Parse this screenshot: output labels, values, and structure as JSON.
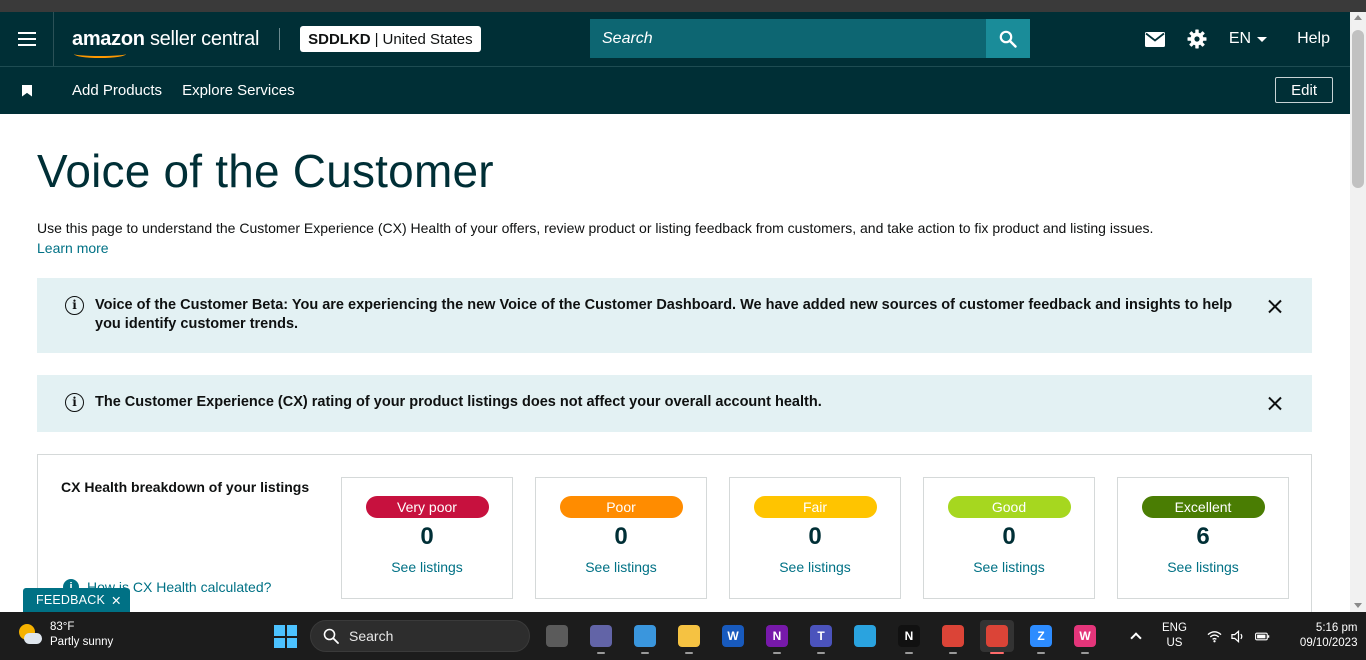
{
  "header": {
    "logo_brand": "amazon",
    "logo_product": "seller central",
    "store_code": "SDDLKD",
    "store_separator": "|",
    "store_country": "United States",
    "search_placeholder": "Search",
    "language": "EN",
    "help": "Help"
  },
  "subnav": {
    "items": [
      "Add Products",
      "Explore Services"
    ],
    "edit": "Edit"
  },
  "page": {
    "title": "Voice of the Customer",
    "intro": "Use this page to understand the Customer Experience (CX) Health of your offers, review product or listing feedback from customers, and take action to fix product and listing issues.",
    "learn_more": "Learn more"
  },
  "alerts": [
    "Voice of the Customer Beta: You are experiencing the new Voice of the Customer Dashboard. We have added new sources of customer feedback and insights to help you identify customer trends.",
    "The Customer Experience (CX) rating of your product listings does not affect your overall account health."
  ],
  "cx": {
    "heading": "CX Health breakdown of your listings",
    "how": "How is CX Health calculated?",
    "cards": [
      {
        "label": "Very poor",
        "count": "0",
        "link": "See listings",
        "color": "#c7113e"
      },
      {
        "label": "Poor",
        "count": "0",
        "link": "See listings",
        "color": "#ff8c00"
      },
      {
        "label": "Fair",
        "count": "0",
        "link": "See listings",
        "color": "#ffc400"
      },
      {
        "label": "Good",
        "count": "0",
        "link": "See listings",
        "color": "#a6d71f"
      },
      {
        "label": "Excellent",
        "count": "6",
        "link": "See listings",
        "color": "#4a7d03"
      }
    ]
  },
  "feedback": "FEEDBACK",
  "taskbar": {
    "temperature": "83°F",
    "weather": "Partly sunny",
    "search": "Search",
    "lang_top": "ENG",
    "lang_bottom": "US",
    "time": "5:16 pm",
    "date": "09/10/2023",
    "apps": [
      {
        "icon": "task-view-icon",
        "color": "#5b5b5b",
        "glyph": ""
      },
      {
        "icon": "teams-meet-icon",
        "color": "#6264a7",
        "glyph": ""
      },
      {
        "icon": "notepad-icon",
        "color": "#3a96dd",
        "glyph": ""
      },
      {
        "icon": "file-explorer-icon",
        "color": "#f5c242",
        "glyph": ""
      },
      {
        "icon": "word-icon",
        "color": "#185abd",
        "glyph": "W"
      },
      {
        "icon": "onenote-icon",
        "color": "#7719aa",
        "glyph": "N"
      },
      {
        "icon": "teams-icon",
        "color": "#4b53bc",
        "glyph": "T"
      },
      {
        "icon": "telegram-icon",
        "color": "#2aa3df",
        "glyph": ""
      },
      {
        "icon": "netflix-icon",
        "color": "#111111",
        "glyph": "N"
      },
      {
        "icon": "chrome-icon",
        "color": "#db4437",
        "glyph": ""
      },
      {
        "icon": "chrome-profile-icon",
        "color": "#db4437",
        "glyph": ""
      },
      {
        "icon": "zoom-icon",
        "color": "#2d8cff",
        "glyph": "Z"
      },
      {
        "icon": "wps-icon",
        "color": "#e4357a",
        "glyph": "W"
      }
    ]
  }
}
